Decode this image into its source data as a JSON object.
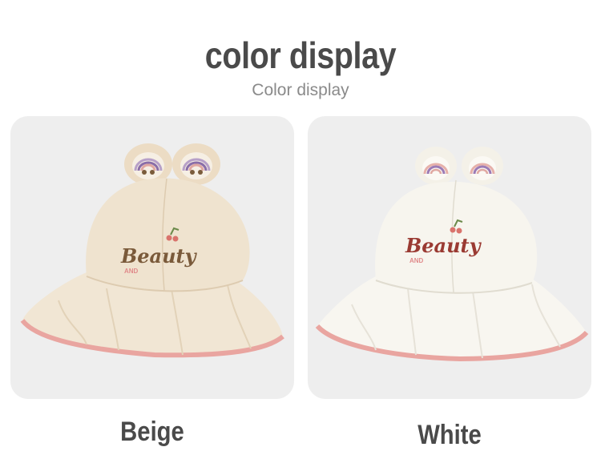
{
  "header": {
    "title": "color display",
    "subtitle": "Color display"
  },
  "variants": [
    {
      "name": "Beige",
      "hat_color": "#efe3cf",
      "hat_shade": "#e2d2b8",
      "trim_color": "#e9a5a0",
      "embroidery_text": "Beauty",
      "embroidery_subtext": "AND"
    },
    {
      "name": "White",
      "hat_color": "#f7f5ee",
      "hat_shade": "#e6e2d8",
      "trim_color": "#e9a5a0",
      "embroidery_text": "Beauty",
      "embroidery_subtext": "AND"
    }
  ]
}
